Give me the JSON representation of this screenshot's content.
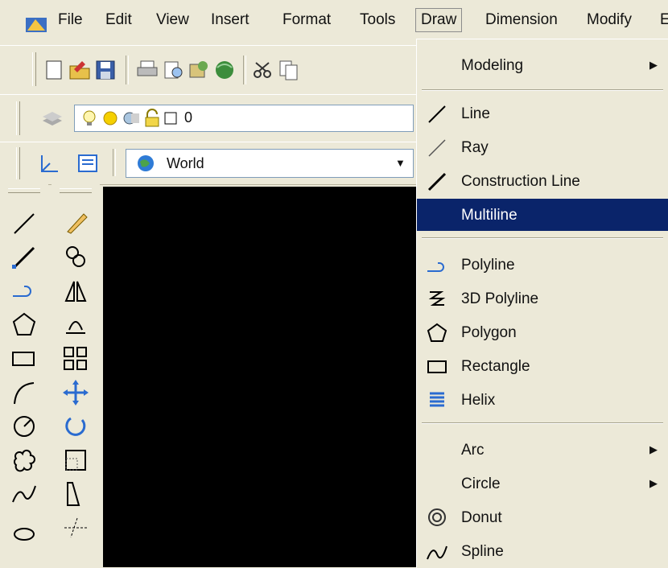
{
  "menubar": {
    "items": [
      "File",
      "Edit",
      "View",
      "Insert",
      "Format",
      "Tools",
      "Draw",
      "Dimension",
      "Modify",
      "E"
    ],
    "active": "Draw"
  },
  "layer_toolbar": {
    "layer_name": "0"
  },
  "ucs_toolbar": {
    "ucs_value": "World"
  },
  "draw_menu": {
    "modeling": "Modeling",
    "line": "Line",
    "ray": "Ray",
    "construction_line": "Construction Line",
    "multiline": "Multiline",
    "polyline": "Polyline",
    "polyline_3d": "3D Polyline",
    "polygon": "Polygon",
    "rectangle": "Rectangle",
    "helix": "Helix",
    "arc": "Arc",
    "circle": "Circle",
    "donut": "Donut",
    "spline": "Spline"
  },
  "colors": {
    "highlight": "#0a246a",
    "canvas": "#000000",
    "face": "#ece9d8"
  }
}
